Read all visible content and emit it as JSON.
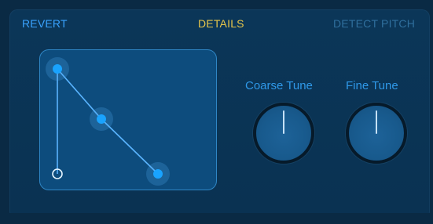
{
  "header": {
    "revert_label": "REVERT",
    "details_label": "DETAILS",
    "detect_pitch_label": "DETECT PITCH"
  },
  "knobs": {
    "coarse_tune_label": "Coarse Tune",
    "fine_tune_label": "Fine Tune"
  },
  "colors": {
    "accent_blue": "#3aa3ff",
    "details_yellow": "#e7c64a",
    "disabled_blue": "#2f6f9d",
    "panel_bg": "#0b3658",
    "editor_bg": "#0d4c7d"
  }
}
